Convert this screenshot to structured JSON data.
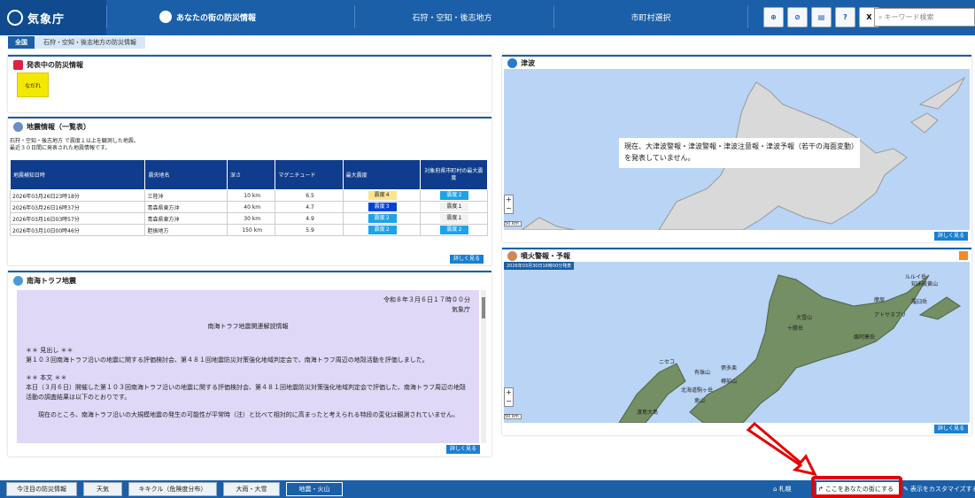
{
  "header": {
    "logo_text": "気象庁",
    "nav_local": "あなたの街の防災情報",
    "nav_region": "石狩・空知・後志地方",
    "nav_city": "市町村選択",
    "tool_buttons": [
      "GPS",
      "PRINT",
      "印刷",
      "HELP",
      "X"
    ],
    "search_placeholder": "キーワード検索"
  },
  "breadcrumb": {
    "home": "全国",
    "current": "石狩・空知・後志地方の防災情報"
  },
  "warnings": {
    "title": "発表中の防災情報",
    "badge": "なだれ"
  },
  "quake": {
    "title": "地震情報（一覧表）",
    "desc1": "石狩・空知・後志地方 で震度１以上を観測した地震。",
    "desc2": "最近３０日間に発表された地震情報です。",
    "columns": [
      "地震検知日時",
      "震央地名",
      "深さ",
      "マグニチュード",
      "最大震度",
      "対象府県市町村の最大震度"
    ],
    "rows": [
      {
        "time": "2026年03月26日23時18分",
        "place": "三陸沖",
        "depth": "10 km",
        "mag": "6.5",
        "max": "震度４",
        "local": "震度２"
      },
      {
        "time": "2026年03月26日16時37分",
        "place": "青森県東方沖",
        "depth": "40 km",
        "mag": "4.7",
        "max": "震度３",
        "local": "震度１"
      },
      {
        "time": "2026年03月16日03時57分",
        "place": "青森県東方沖",
        "depth": "30 km",
        "mag": "4.9",
        "max": "震度２",
        "local": "震度１"
      },
      {
        "time": "2026年03月10日00時46分",
        "place": "胆振地方",
        "depth": "150 km",
        "mag": "5.9",
        "max": "震度２",
        "local": "震度２"
      }
    ],
    "more": "詳しく見る"
  },
  "nankai": {
    "title": "南海トラフ地震",
    "date": "令和８年３月６日１７時００分",
    "org": "気象庁",
    "heading": "南海トラフ地震関連解説情報",
    "p1": "＊＊ 見出し ＊＊",
    "p2": "第１０３回南海トラフ沿いの地震に関する評価検討会、第４８１回地震防災対策強化地域判定会で、南海トラフ周辺の地殻活動を評価しました。",
    "p3": "＊＊ 本文 ＊＊",
    "p4": "本日（３月６日）開催した第１０３回南海トラフ沿いの地震に関する評価検討会、第４８１回地震防災対策強化地域判定会で評価した、南海トラフ周辺の地殻活動の調査結果は以下のとおりです。",
    "p5": "現在のところ、南海トラフ沿いの大規模地震の発生の可能性が平常時（注）と比べて相対的に高まったと考えられる特段の変化は観測されていません。",
    "more": "詳しく見る"
  },
  "tsunami": {
    "title": "津波",
    "message": "現在、大津波警報・津波警報・津波注意報・津波予報（若干の海面変動）を発表していません。",
    "more": "詳しく見る",
    "zoom_in": "+",
    "zoom_out": "−",
    "scale": "50 km"
  },
  "volcano": {
    "title": "噴火警報・予報",
    "stamp": "2026年03月30日16時00分発表",
    "more": "詳しく見る",
    "zoom_in": "+",
    "zoom_out": "−",
    "scale": "50 km",
    "labels": [
      "ルルイ岳",
      "知床硫黄山",
      "羅臼岳",
      "摩周",
      "アトサヌプリ",
      "雌阿寒岳",
      "大雪山",
      "十勝岳",
      "樽前山",
      "倶多楽",
      "有珠山",
      "ニセコ",
      "北海道駒ヶ岳",
      "恵山",
      "渡島大島"
    ]
  },
  "bottom": {
    "tabs": [
      "今注目の防災情報",
      "天気",
      "キキクル（危険度分布）",
      "大雨・大雪",
      "地震・火山"
    ],
    "right1": "札幌",
    "right2": "ここをあなたの街にする",
    "right3": "表示をカスタマイズする"
  }
}
